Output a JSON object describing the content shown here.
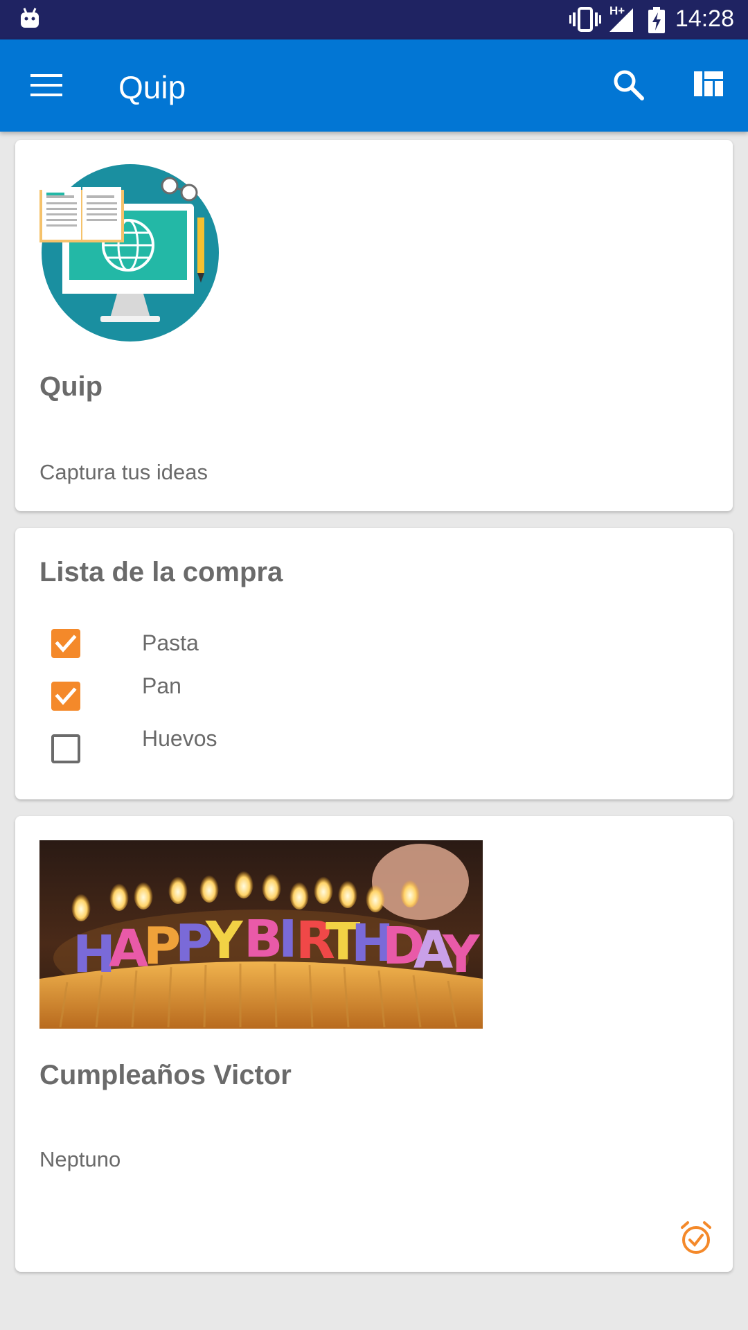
{
  "status_bar": {
    "time": "14:28",
    "network": "H+",
    "icons": [
      "android-icon",
      "vibrate-icon",
      "signal-icon",
      "battery-charging-icon"
    ]
  },
  "app_bar": {
    "title": "Quip",
    "icons": [
      "menu-icon",
      "search-icon",
      "layout-icon"
    ],
    "color": "#0276d4"
  },
  "notes": [
    {
      "title": "Quip",
      "subtitle": "Captura tus ideas",
      "image": "computer-globe-illustration"
    },
    {
      "title": "Lista de la compra",
      "items": [
        {
          "label": "Pasta",
          "checked": true
        },
        {
          "label": "Pan",
          "checked": true
        },
        {
          "label": "Huevos",
          "checked": false
        }
      ]
    },
    {
      "title": "Cumpleaños Victor",
      "subtitle": "Neptuno",
      "image": "birthday-cake-photo",
      "photo_text": "HAPPY BIRTHDAY",
      "reminder_icon": "alarm-icon"
    }
  ],
  "colors": {
    "status_bar": "#1f2362",
    "accent": "#f4892a",
    "background": "#e8e8e8"
  }
}
